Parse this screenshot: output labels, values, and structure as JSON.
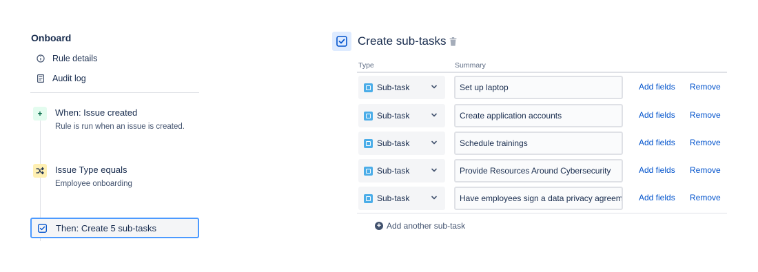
{
  "sidebar": {
    "rule_name": "Onboard",
    "nav": [
      {
        "label": "Rule details",
        "icon": "info-icon"
      },
      {
        "label": "Audit log",
        "icon": "document-icon"
      }
    ]
  },
  "flow": {
    "trigger": {
      "title": "When: Issue created",
      "description": "Rule is run when an issue is created.",
      "icon": "plus-icon",
      "badge": "+"
    },
    "condition": {
      "title": "Issue Type equals",
      "description": "Employee onboarding",
      "icon": "shuffle-icon"
    },
    "action": {
      "title": "Then: Create 5 sub-tasks",
      "icon": "subtask-icon"
    }
  },
  "editor": {
    "title": "Create sub-tasks",
    "columns": {
      "type": "Type",
      "summary": "Summary"
    },
    "rows": [
      {
        "type": "Sub-task",
        "summary": "Set up laptop",
        "add_fields": "Add fields",
        "remove": "Remove"
      },
      {
        "type": "Sub-task",
        "summary": "Create application accounts",
        "add_fields": "Add fields",
        "remove": "Remove"
      },
      {
        "type": "Sub-task",
        "summary": "Schedule trainings",
        "add_fields": "Add fields",
        "remove": "Remove"
      },
      {
        "type": "Sub-task",
        "summary": "Provide Resources Around Cybersecurity",
        "add_fields": "Add fields",
        "remove": "Remove"
      },
      {
        "type": "Sub-task",
        "summary": "Have employees sign a data privacy agreeme",
        "add_fields": "Add fields",
        "remove": "Remove"
      }
    ],
    "add_another": "Add another sub-task"
  },
  "colors": {
    "link": "#0052cc",
    "accent": "#4c9aff",
    "subtask": "#4bade8",
    "trigger_bg": "#e3fcef",
    "condition_bg": "#fff0b3"
  }
}
